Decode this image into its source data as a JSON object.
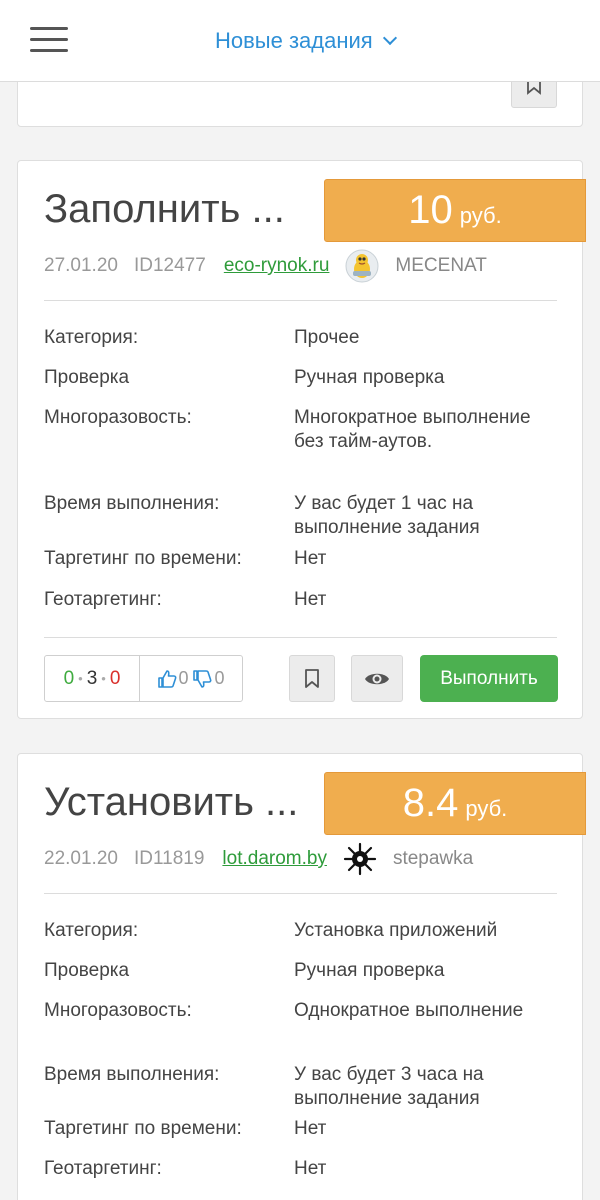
{
  "header": {
    "title": "Новые задания"
  },
  "tasks": [
    {
      "title": "Заполнить ...",
      "price": "10",
      "currency": "руб.",
      "date": "27.01.20",
      "id": "ID12477",
      "site": "eco-rynok.ru",
      "user": "MECENAT",
      "details": [
        {
          "label": "Категория:",
          "value": "Прочее"
        },
        {
          "label": "Проверка",
          "value": "Ручная проверка"
        },
        {
          "label": "Многоразовость:",
          "value": "Многократное выполнение без тайм-аутов."
        },
        {
          "label": "Время выполнения:",
          "value": "У вас будет 1 час на выполнение задания"
        },
        {
          "label": "Таргетинг по времени:",
          "value": "Нет"
        },
        {
          "label": "Геотаргетинг:",
          "value": "Нет"
        }
      ],
      "stats": {
        "positive": "0",
        "neutral": "3",
        "negative": "0",
        "likes": "0",
        "dislikes": "0"
      },
      "do_label": "Выполнить"
    },
    {
      "title": "Установить ...",
      "price": "8.4",
      "currency": "руб.",
      "date": "22.01.20",
      "id": "ID11819",
      "site": "lot.darom.by",
      "user": "stepawka",
      "details": [
        {
          "label": "Категория:",
          "value": "Установка приложений"
        },
        {
          "label": "Проверка",
          "value": "Ручная проверка"
        },
        {
          "label": "Многоразовость:",
          "value": "Однократное выполнение"
        },
        {
          "label": "Время выполнения:",
          "value": "У вас будет 3 часа на выполнение задания"
        },
        {
          "label": "Таргетинг по времени:",
          "value": "Нет"
        },
        {
          "label": "Геотаргетинг:",
          "value": "Нет"
        }
      ]
    }
  ],
  "colors": {
    "accent": "#2e8fd6",
    "price": "#f0ad4e",
    "success": "#4cb050",
    "link": "#2e9b3a"
  }
}
